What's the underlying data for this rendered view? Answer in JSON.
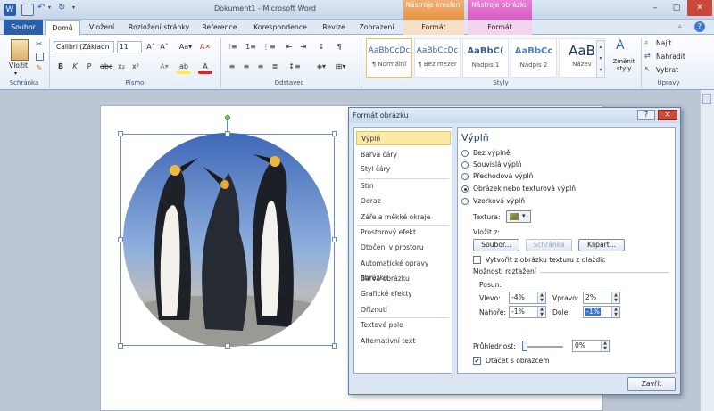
{
  "window": {
    "title": "Dokument1 - Microsoft Word",
    "context_tabs": [
      {
        "group": "Nástroje kreslení",
        "tab": "Formát"
      },
      {
        "group": "Nástroje obrázku",
        "tab": "Formát"
      }
    ]
  },
  "tabs": [
    "Soubor",
    "Domů",
    "Vložení",
    "Rozložení stránky",
    "Reference",
    "Korespondence",
    "Revize",
    "Zobrazení"
  ],
  "ribbon": {
    "clipboard": {
      "paste": "Vložit",
      "label": "Schránka"
    },
    "font": {
      "name": "Calibri (Základn",
      "size": "11",
      "label": "Písmo"
    },
    "paragraph": {
      "label": "Odstavec"
    },
    "styles": {
      "items": [
        {
          "preview": "AaBbCcDc",
          "name": "¶ Normální"
        },
        {
          "preview": "AaBbCcDc",
          "name": "¶ Bez mezer"
        },
        {
          "preview": "AaBbC(",
          "name": "Nadpis 1"
        },
        {
          "preview": "AaBbCc",
          "name": "Nadpis 2"
        },
        {
          "preview": "AaB",
          "name": "Název"
        }
      ],
      "change": "Změnit styly",
      "label": "Styly"
    },
    "editing": {
      "find": "Najít",
      "replace": "Nahradit",
      "select": "Vybrat",
      "label": "Úpravy"
    }
  },
  "dialog": {
    "title": "Formát obrázku",
    "nav": [
      "Výplň",
      "Barva čáry",
      "Styl čáry",
      "Stín",
      "Odraz",
      "Záře a měkké okraje",
      "Prostorový efekt",
      "Otočení v prostoru",
      "Automatické opravy obrázku",
      "Barva obrázku",
      "Grafické efekty",
      "Oříznutí",
      "Textové pole",
      "Alternativní text"
    ],
    "panel": {
      "heading": "Výplň",
      "options": [
        "Bez výplně",
        "Souvislá výplň",
        "Přechodová výplň",
        "Obrázek nebo texturová výplň",
        "Vzorková výplň"
      ],
      "selected": 3,
      "texture_label": "Textura:",
      "insert_label": "Vložit z:",
      "btn_file": "Soubor...",
      "btn_clipboard": "Schránka",
      "btn_clipart": "Klipart...",
      "tile_check": "Vytvořit z obrázku texturu z dlaždic",
      "stretch_label": "Možnosti roztažení",
      "offsets_label": "Posun:",
      "left_label": "Vlevo:",
      "left_val": "-4%",
      "right_label": "Vpravo:",
      "right_val": "2%",
      "top_label": "Nahoře:",
      "top_val": "-1%",
      "bottom_label": "Dole:",
      "bottom_val": "-1%",
      "transparency_label": "Průhlednost:",
      "transparency_val": "0%",
      "transparency_level": 0,
      "rotate_check": "Otáčet s obrazcem"
    },
    "close_button": "Zavřít"
  }
}
